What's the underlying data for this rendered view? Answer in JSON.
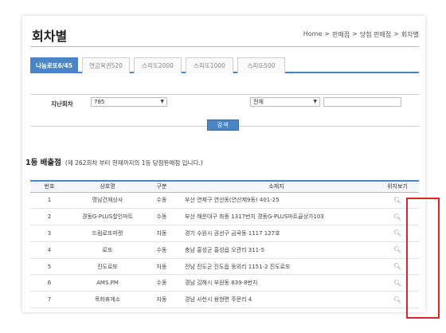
{
  "page": {
    "title": "회차별"
  },
  "breadcrumb": [
    "Home",
    ">",
    "판매점",
    ">",
    "당첨 판매점",
    ">",
    "회차별"
  ],
  "tabs": [
    {
      "label": "나눔로또6/45",
      "active": true
    },
    {
      "label": "연금복권520",
      "active": false
    },
    {
      "label": "스피또2000",
      "active": false
    },
    {
      "label": "스피또1000",
      "active": false
    },
    {
      "label": "스피또500",
      "active": false
    }
  ],
  "filter": {
    "round_label": "지난회차",
    "round_value": "785",
    "region_value": "전체",
    "search_button": "검색"
  },
  "section": {
    "heading": "1등 배출점",
    "subtitle": "(제 262회차 부터 현재까지의 1등 당첨판매점 입니다.)"
  },
  "table": {
    "headers": [
      "번호",
      "상호명",
      "구분",
      "소재지",
      "위치보기"
    ],
    "rows": [
      {
        "no": "1",
        "name": "명남건재상사",
        "type": "수동",
        "address": "부산 연제구 연산동(연산제9동) 401-25"
      },
      {
        "no": "2",
        "name": "경동G-PLUS할인마트",
        "type": "수동",
        "address": "부산 해운대구 좌동 1317번지 경동G-PLUS마트골상가103"
      },
      {
        "no": "3",
        "name": "드림로또마켓",
        "type": "자동",
        "address": "경기 수원시 권선구 금곡동 1117 127호"
      },
      {
        "no": "4",
        "name": "로또",
        "type": "수동",
        "address": "충남 홍성군 홍성읍 오관리 311-5"
      },
      {
        "no": "5",
        "name": "진도로또",
        "type": "자동",
        "address": "전남 진도군 진도읍 동외리 1151-2 진도로또"
      },
      {
        "no": "6",
        "name": "AMS.PM",
        "type": "수동",
        "address": "경남 김해시 부원동 839-8번지"
      },
      {
        "no": "7",
        "name": "목화휴게소",
        "type": "자동",
        "address": "경남 사천시 용현면 주문리 4"
      }
    ]
  },
  "icons": {
    "location": "magnifier-icon",
    "dropdown": "caret-down-icon"
  },
  "colors": {
    "accent": "#4a86c5",
    "highlight": "#e0262b"
  }
}
